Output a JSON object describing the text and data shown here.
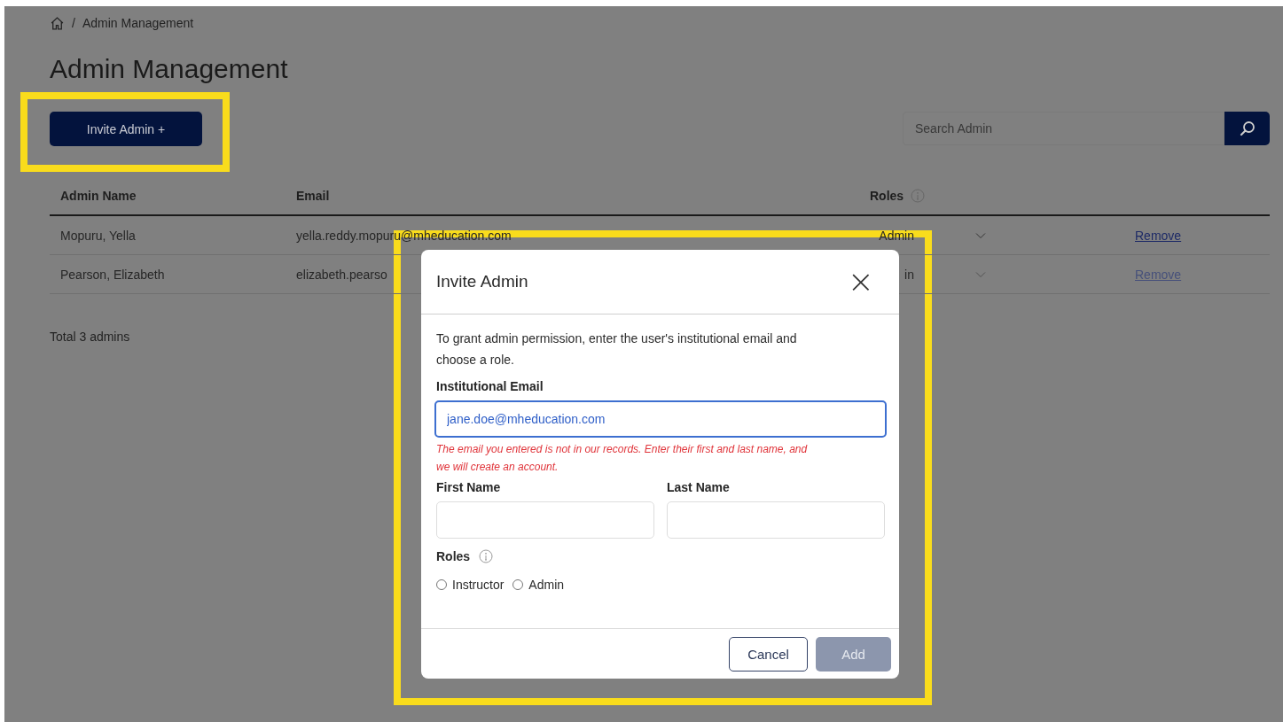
{
  "breadcrumb": {
    "current": "Admin Management",
    "separator": "/"
  },
  "page_title": "Admin Management",
  "invite_button": {
    "label": "Invite Admin +"
  },
  "search": {
    "placeholder": "Search Admin"
  },
  "table": {
    "columns": [
      {
        "label": "Admin Name",
        "kind": "plain"
      },
      {
        "label": "Email",
        "kind": "plain"
      },
      {
        "label": "Roles",
        "kind": "info"
      }
    ],
    "rows": [
      {
        "name": "Mopuru, Yella",
        "email": "yella.reddy.mopuru@mheducation.com",
        "role": "Admin",
        "action": "Remove",
        "disabled": false
      },
      {
        "name": "Pearson, Elizabeth",
        "email": "elizabeth.pearso",
        "role": "in",
        "action": "Remove",
        "disabled": true
      }
    ]
  },
  "total": "Total 3 admins",
  "dialog": {
    "title": "Invite Admin",
    "close": "×",
    "intro": "To grant admin permission, enter the user's institutional email and choose a role.",
    "email": {
      "label": "Institutional Email",
      "value": "jane.doe@mheducation.com",
      "focused": true,
      "error": "The email you entered is not in our records. Enter their first and last name, and we will create an account."
    },
    "first_name": {
      "label": "First Name"
    },
    "last_name": {
      "label": "Last Name"
    },
    "roles": {
      "label": "Roles",
      "options": [
        {
          "label": "Instructor",
          "selected": false
        },
        {
          "label": "Admin",
          "selected": false
        }
      ]
    },
    "buttons": [
      {
        "label": "Cancel",
        "kind": "secondary",
        "disabled": false
      },
      {
        "label": "Add",
        "kind": "primary",
        "disabled": true
      }
    ]
  }
}
